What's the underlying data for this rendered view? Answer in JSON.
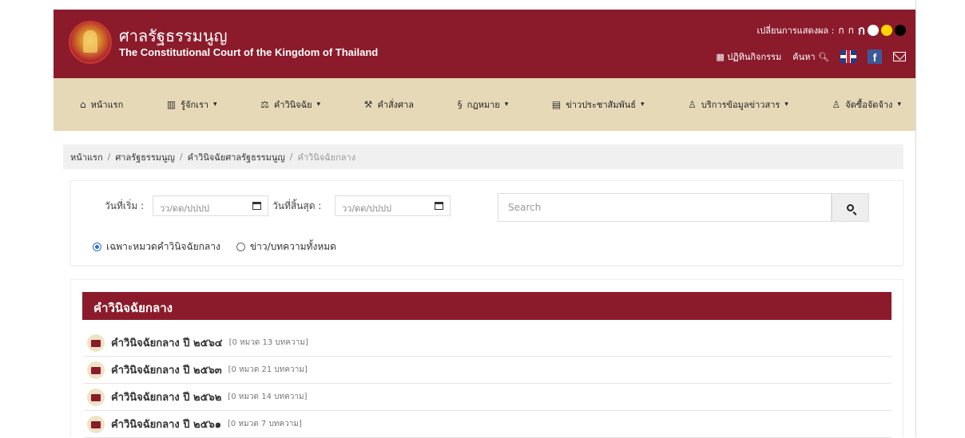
{
  "header": {
    "title_th": "ศาลรัฐธรรมนูญ",
    "title_en": "The Constitutional Court of the Kingdom of Thailand",
    "display_label": "เปลี่ยนการแสดงผล :",
    "font_sizes": [
      "ก",
      "ก",
      "ก"
    ],
    "theme_colors": [
      "#ffffff",
      "#ffd400",
      "#000000"
    ],
    "calendar_label": "ปฏิทินกิจกรรม",
    "search_label": "ค้นหา"
  },
  "nav": {
    "items": [
      {
        "label": "หน้าแรก",
        "icon": "home-icon",
        "dropdown": false
      },
      {
        "label": "รู้จักเรา",
        "icon": "book-icon",
        "dropdown": true
      },
      {
        "label": "คำวินิจฉัย",
        "icon": "scales-icon",
        "dropdown": true
      },
      {
        "label": "คำสั่งศาล",
        "icon": "gavel-icon",
        "dropdown": false
      },
      {
        "label": "กฎหมาย",
        "icon": "law-icon",
        "dropdown": true
      },
      {
        "label": "ข่าวประชาสัมพันธ์",
        "icon": "newspaper-icon",
        "dropdown": true
      },
      {
        "label": "บริการข้อมูลข่าวสาร",
        "icon": "person-icon",
        "dropdown": true
      },
      {
        "label": "จัดซื้อจัดจ้าง",
        "icon": "person-icon",
        "dropdown": true
      }
    ]
  },
  "breadcrumb": [
    "หน้าแรก",
    "ศาลรัฐธรรมนูญ",
    "คำวินิจฉัยศาลรัฐธรรมนูญ",
    "คำวินิจฉัยกลาง"
  ],
  "filter": {
    "start_label": "วันที่เริ่ม :",
    "end_label": "วันที่สิ้นสุด :",
    "date_placeholder": "วว/ดด/ปปปป",
    "search_placeholder": "Search",
    "radio_1": "เฉพาะหมวดคำวินิจฉัยกลาง",
    "radio_2": "ข่าว/บทความทั้งหมด"
  },
  "section_title": "คำวินิจฉัยกลาง",
  "items": [
    {
      "title": "คำวินิจฉัยกลาง ปี ๒๕๖๔",
      "meta": "[0 หมวด 13 บทความ]"
    },
    {
      "title": "คำวินิจฉัยกลาง ปี ๒๕๖๓",
      "meta": "[0 หมวด 21 บทความ]"
    },
    {
      "title": "คำวินิจฉัยกลาง ปี ๒๕๖๒",
      "meta": "[0 หมวด 14 บทความ]"
    },
    {
      "title": "คำวินิจฉัยกลาง ปี ๒๕๖๑",
      "meta": "[0 หมวด 7 บทความ]"
    }
  ]
}
